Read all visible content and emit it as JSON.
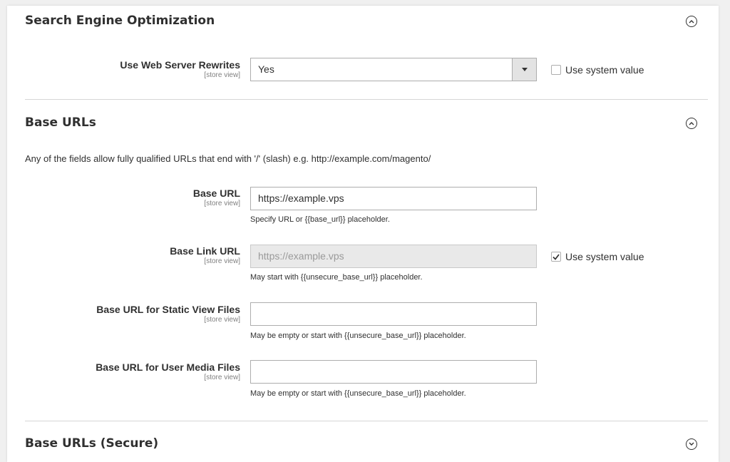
{
  "sections": {
    "seo": {
      "title": "Search Engine Optimization",
      "toggle": "collapse-icon"
    },
    "base_urls": {
      "title": "Base URLs",
      "toggle": "collapse-icon",
      "intro": "Any of the fields allow fully qualified URLs that end with '/' (slash) e.g. http://example.com/magento/"
    },
    "base_urls_secure": {
      "title": "Base URLs (Secure)",
      "toggle": "expand-icon"
    }
  },
  "fields": {
    "web_server_rewrites": {
      "label": "Use Web Server Rewrites",
      "scope": "[store view]",
      "value": "Yes",
      "use_system_value": false,
      "system_value_label": "Use system value"
    },
    "base_url": {
      "label": "Base URL",
      "scope": "[store view]",
      "value": "https://example.vps",
      "note": "Specify URL or {{base_url}} placeholder."
    },
    "base_link_url": {
      "label": "Base Link URL",
      "scope": "[store view]",
      "value": "https://example.vps",
      "note": "May start with {{unsecure_base_url}} placeholder.",
      "use_system_value": true,
      "system_value_label": "Use system value"
    },
    "base_static_url": {
      "label": "Base URL for Static View Files",
      "scope": "[store view]",
      "value": "",
      "note": "May be empty or start with {{unsecure_base_url}} placeholder."
    },
    "base_media_url": {
      "label": "Base URL for User Media Files",
      "scope": "[store view]",
      "value": "",
      "note": "May be empty or start with {{unsecure_base_url}} placeholder."
    }
  },
  "colors": {
    "text": "#303030",
    "scope_text": "#808080",
    "border": "#adadad",
    "disabled_bg": "#e9e9e9",
    "divider": "#d6d6d6"
  }
}
